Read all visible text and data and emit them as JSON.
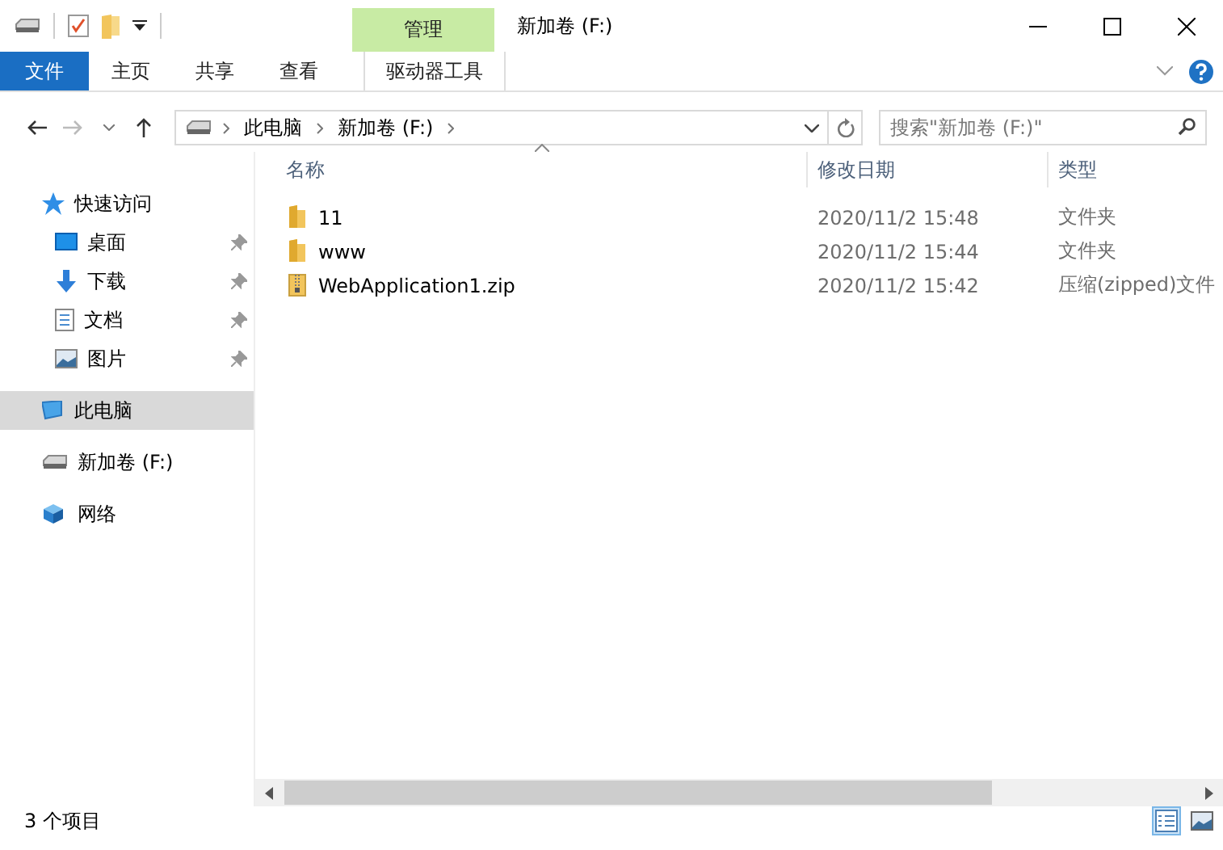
{
  "window": {
    "title": "新加卷 (F:)",
    "context_tab": "管理"
  },
  "ribbon": {
    "tabs": [
      {
        "label": "文件",
        "kind": "file",
        "selected": false
      },
      {
        "label": "主页",
        "kind": "normal",
        "selected": false
      },
      {
        "label": "共享",
        "kind": "normal",
        "selected": false
      },
      {
        "label": "查看",
        "kind": "normal",
        "selected": false
      },
      {
        "label": "驱动器工具",
        "kind": "context",
        "selected": false
      }
    ]
  },
  "address": {
    "crumbs": [
      "此电脑",
      "新加卷 (F:)"
    ]
  },
  "search": {
    "placeholder": "搜索\"新加卷 (F:)\""
  },
  "sidebar": {
    "items": [
      {
        "label": "快速访问",
        "kind": "star",
        "selected": false,
        "children": [
          {
            "label": "桌面",
            "kind": "desktop",
            "pinned": true,
            "selected": false
          },
          {
            "label": "下载",
            "kind": "download",
            "pinned": true,
            "selected": false
          },
          {
            "label": "文档",
            "kind": "document",
            "pinned": true,
            "selected": false
          },
          {
            "label": "图片",
            "kind": "picture",
            "pinned": true,
            "selected": false
          }
        ]
      },
      {
        "label": "此电脑",
        "kind": "pc",
        "selected": true
      },
      {
        "label": "新加卷 (F:)",
        "kind": "drive",
        "selected": false
      },
      {
        "label": "网络",
        "kind": "network",
        "selected": false
      }
    ]
  },
  "table": {
    "columns": [
      "名称",
      "修改日期",
      "类型"
    ],
    "rows": [
      {
        "name": "11",
        "kind": "folder",
        "modified": "2020/11/2 15:48",
        "type": "文件夹"
      },
      {
        "name": "www",
        "kind": "folder",
        "modified": "2020/11/2 15:44",
        "type": "文件夹"
      },
      {
        "name": "WebApplication1.zip",
        "kind": "zip",
        "modified": "2020/11/2 15:42",
        "type": "压缩(zipped)文件"
      }
    ]
  },
  "status_bar": {
    "item_count": "3 个项目",
    "views": [
      {
        "kind": "details",
        "selected": true
      },
      {
        "kind": "icons",
        "selected": false
      }
    ]
  }
}
